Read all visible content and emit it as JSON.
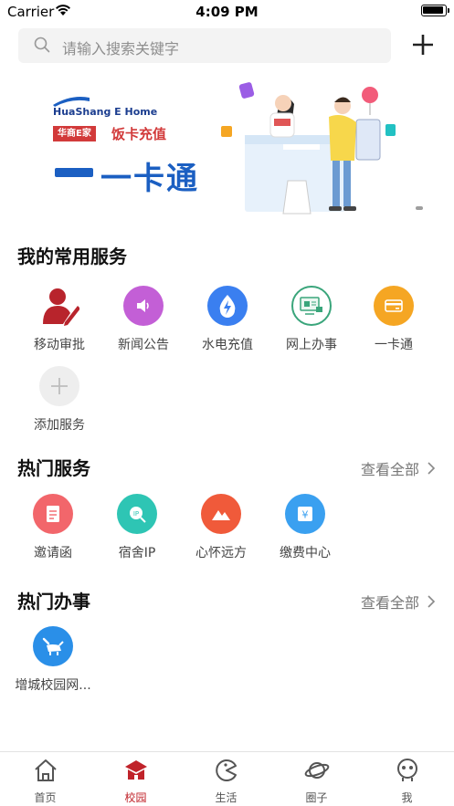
{
  "status": {
    "carrier": "Carrier",
    "time": "4:09 PM"
  },
  "search": {
    "placeholder": "请输入搜索关键字"
  },
  "banner": {
    "logo_text": "HuaShang E Home",
    "tag1": "华商E家",
    "tag2": "饭卡充值",
    "title": "一卡通"
  },
  "frequent": {
    "title": "我的常用服务",
    "items": [
      {
        "label": "移动审批",
        "icon": "approval-icon",
        "color": "#b8242c"
      },
      {
        "label": "新闻公告",
        "icon": "speaker-icon",
        "color": "#c35fd6"
      },
      {
        "label": "水电充值",
        "icon": "bolt-drop-icon",
        "color": "#3a7ff0"
      },
      {
        "label": "网上办事",
        "icon": "online-service-icon",
        "color": "#3aa57b"
      },
      {
        "label": "一卡通",
        "icon": "card-icon",
        "color": "#f5a623"
      },
      {
        "label": "添加服务",
        "icon": "plus-icon",
        "color": "#eeeeee"
      }
    ]
  },
  "hot_services": {
    "title": "热门服务",
    "view_all": "查看全部",
    "items": [
      {
        "label": "邀请函",
        "icon": "invitation-icon",
        "color": "#f2666b"
      },
      {
        "label": "宿舍IP",
        "icon": "ip-search-icon",
        "color": "#2ec5b4"
      },
      {
        "label": "心怀远方",
        "icon": "mountain-icon",
        "color": "#f05a3a"
      },
      {
        "label": "缴费中心",
        "icon": "payment-icon",
        "color": "#3aa0f0"
      }
    ]
  },
  "hot_affairs": {
    "title": "热门办事",
    "view_all": "查看全部",
    "items": [
      {
        "label": "增城校园网...",
        "icon": "wrench-cow-icon",
        "color": "#2a8fe8"
      }
    ]
  },
  "tabbar": {
    "active_color": "#c0232a",
    "items": [
      {
        "label": "首页",
        "icon": "home-icon"
      },
      {
        "label": "校园",
        "icon": "school-icon"
      },
      {
        "label": "生活",
        "icon": "life-icon"
      },
      {
        "label": "圈子",
        "icon": "planet-icon"
      },
      {
        "label": "我",
        "icon": "profile-icon"
      }
    ]
  }
}
